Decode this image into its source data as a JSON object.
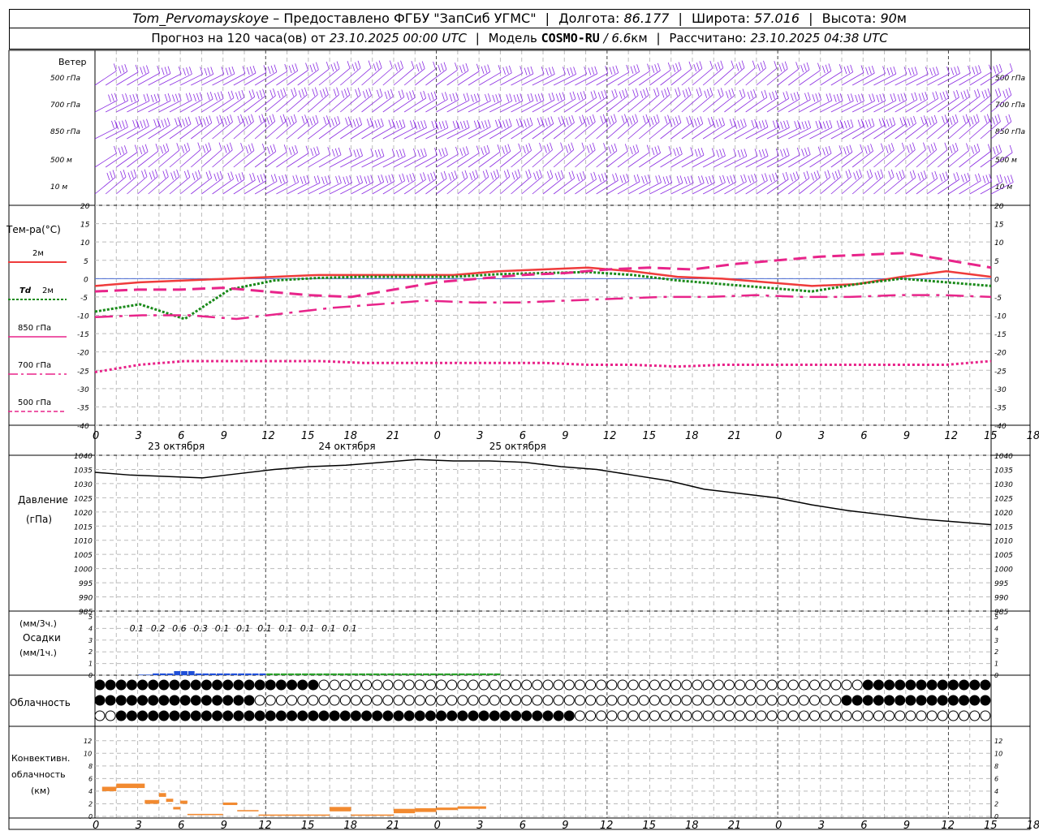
{
  "header": {
    "station": "Tom_Pervomayskoye",
    "provided_by": "– Предоставлено ФГБУ \"ЗапСиб УГМС\"",
    "lon_label": "Долгота:",
    "lon_value": "86.177",
    "lat_label": "Широта:",
    "lat_value": "57.016",
    "alt_label": "Высота:",
    "alt_value": "90",
    "alt_unit": "м",
    "forecast_prefix": "Прогноз на 120 часа(ов) от",
    "forecast_time": "23.10.2025 00:00 UTC",
    "model_label": "Модель",
    "model_name": "COSMO-RU",
    "model_res": "/ 6.6",
    "model_res_unit": "км",
    "calc_label": "Рассчитано:",
    "calc_time": "23.10.2025 04:38 UTC"
  },
  "x_ticks": [
    "0",
    "3",
    "6",
    "9",
    "12",
    "15",
    "18",
    "21",
    "0",
    "3",
    "6",
    "9",
    "12",
    "15",
    "18",
    "21",
    "0",
    "3",
    "6",
    "9",
    "12",
    "15",
    "18",
    "21",
    "0",
    "3",
    "6"
  ],
  "day_labels": [
    "23 октября",
    "24 октября",
    "25 октября"
  ],
  "wind_panel": {
    "title": "Ветер",
    "levels": [
      "500 гПа",
      "700 гПа",
      "850 гПа",
      "500 м",
      "10 м"
    ],
    "color": "#8a2be2"
  },
  "temp_panel": {
    "title": "Тем-ра(°С)",
    "y_ticks": [
      "20",
      "15",
      "10",
      "5",
      "0",
      "-5",
      "-10",
      "-15",
      "-20",
      "-25",
      "-30",
      "-35",
      "-40"
    ],
    "legend": [
      {
        "label": "2м",
        "color": "#ef3b3b"
      },
      {
        "label_it": "Td",
        "label": "2м",
        "color": "#1a8a1a"
      },
      {
        "label": "850 гПа",
        "color": "#e8248a"
      },
      {
        "label": "700 гПа",
        "color": "#e8248a"
      },
      {
        "label": "500 гПа",
        "color": "#e8248a"
      }
    ]
  },
  "pressure_panel": {
    "title": "Давление",
    "unit": "(гПа)",
    "y_ticks": [
      "1040",
      "1035",
      "1030",
      "1025",
      "1020",
      "1015",
      "1010",
      "1005",
      "1000",
      "995",
      "990",
      "985"
    ]
  },
  "precip_panel": {
    "unit_top": "(мм/3ч.)",
    "title": "Осадки",
    "unit_bottom": "(мм/1ч.)",
    "y_ticks": [
      "5",
      "4",
      "3",
      "2",
      "1",
      "0"
    ],
    "labels_3h": [
      "0.1",
      "0.2",
      "0.6",
      "0.3",
      "0.1",
      "0.1",
      "0.1",
      "0.1",
      "0.1",
      "0.1",
      "0.1"
    ]
  },
  "cloud_panel": {
    "title": "Облачность"
  },
  "conv_panel": {
    "title_line1": "Конвективн.",
    "title_line2": "облачность",
    "unit": "(км)",
    "y_ticks": [
      "12",
      "10",
      "8",
      "6",
      "4",
      "2",
      "0"
    ]
  },
  "chart_data": [
    {
      "type": "line",
      "title": "Тем-ра(°С)",
      "x_hours": [
        0,
        6,
        12,
        18,
        24,
        30,
        36,
        42,
        48,
        54,
        60,
        66,
        72,
        78,
        84,
        90,
        96,
        102,
        108,
        114,
        120
      ],
      "ylim": [
        -40,
        20
      ],
      "series": [
        {
          "name": "2м",
          "color": "#ef3b3b",
          "values": [
            -2,
            -1,
            -0.5,
            0,
            0.5,
            1,
            1,
            1,
            1,
            2,
            2.5,
            3,
            2,
            0.5,
            0,
            -1,
            -2,
            -1.5,
            0.5,
            2,
            0.5
          ]
        },
        {
          "name": "Td 2м",
          "color": "#1a8a1a",
          "values": [
            -9,
            -7,
            -11,
            -3,
            -0.5,
            0.2,
            0.5,
            0.5,
            0.5,
            1.2,
            1.5,
            1.8,
            1,
            -0.5,
            -1.5,
            -2.5,
            -3.5,
            -1.5,
            0,
            -1,
            -2
          ]
        },
        {
          "name": "850 гПа",
          "color": "#e8248a",
          "values": [
            -3.5,
            -3,
            -3,
            -2.5,
            -3.5,
            -4.5,
            -5,
            -3,
            -1,
            0,
            1,
            1.5,
            2.5,
            3,
            2.5,
            4,
            5,
            6,
            6.5,
            7,
            5,
            3
          ]
        },
        {
          "name": "700 гПа",
          "color": "#e8248a",
          "values": [
            -10.5,
            -10,
            -10,
            -11,
            -9.5,
            -8,
            -7,
            -6,
            -6.5,
            -6.5,
            -6,
            -5.5,
            -5,
            -5,
            -4.5,
            -5,
            -5,
            -4.5,
            -4.5,
            -5
          ]
        },
        {
          "name": "500 гПа",
          "color": "#e8248a",
          "values": [
            -25.5,
            -23.5,
            -22.5,
            -22.5,
            -22.5,
            -22.5,
            -23,
            -23,
            -23,
            -23,
            -23,
            -23.5,
            -23.5,
            -24,
            -23.5,
            -23.5,
            -23.5,
            -23.5,
            -23.5,
            -23.5,
            -22.5
          ]
        }
      ]
    },
    {
      "type": "line",
      "title": "Давление",
      "x_hours": [
        0,
        6,
        12,
        18,
        24,
        30,
        36,
        42,
        48,
        54,
        60,
        66,
        72,
        78,
        84,
        90,
        96,
        102,
        108,
        114,
        120
      ],
      "ylim": [
        985,
        1040
      ],
      "series": [
        {
          "name": "",
          "color": "#000000",
          "values": [
            1034,
            1033,
            1032.5,
            1032,
            1033.5,
            1035,
            1036,
            1036.5,
            1037.5,
            1038.5,
            1038,
            1038,
            1037.5,
            1036,
            1035,
            1033,
            1031,
            1028,
            1026.5,
            1025,
            1022.5,
            1020.5,
            1019,
            1017.5,
            1016.5,
            1015.5
          ]
        }
      ]
    },
    {
      "type": "bar",
      "title": "Осадки",
      "ylim": [
        0,
        5
      ],
      "labels_3h": [
        "0.1",
        "0.2",
        "0.6",
        "0.3",
        "0.1",
        "0.1",
        "0.1",
        "0.1",
        "0.1",
        "0.1",
        "0.1"
      ],
      "label_hours": [
        6,
        9,
        12,
        15,
        18,
        21,
        24,
        27,
        30,
        33,
        36
      ]
    },
    {
      "type": "bar",
      "title": "Конвективн. облачность",
      "ylim": [
        0,
        13
      ],
      "segments": [
        {
          "h0": 1,
          "h1": 3,
          "bottom": 4,
          "top": 4.7
        },
        {
          "h0": 3,
          "h1": 7,
          "bottom": 4.5,
          "top": 5.2
        },
        {
          "h0": 7,
          "h1": 9,
          "bottom": 2,
          "top": 2.6
        },
        {
          "h0": 9,
          "h1": 10,
          "bottom": 3.1,
          "top": 3.7
        },
        {
          "h0": 10,
          "h1": 11,
          "bottom": 2.3,
          "top": 2.8
        },
        {
          "h0": 11,
          "h1": 12,
          "bottom": 1.1,
          "top": 1.5
        },
        {
          "h0": 12,
          "h1": 13,
          "bottom": 2,
          "top": 2.5
        },
        {
          "h0": 13,
          "h1": 18,
          "bottom": 0.2,
          "top": 0.4
        },
        {
          "h0": 18,
          "h1": 20,
          "bottom": 1.8,
          "top": 2.2
        },
        {
          "h0": 20,
          "h1": 23,
          "bottom": 0.8,
          "top": 1
        },
        {
          "h0": 23,
          "h1": 33,
          "bottom": 0.1,
          "top": 0.3
        },
        {
          "h0": 33,
          "h1": 36,
          "bottom": 0.8,
          "top": 1.5
        },
        {
          "h0": 36,
          "h1": 42,
          "bottom": 0.1,
          "top": 0.3
        },
        {
          "h0": 42,
          "h1": 45,
          "bottom": 0.5,
          "top": 1.2
        },
        {
          "h0": 45,
          "h1": 48,
          "bottom": 0.7,
          "top": 1.3
        },
        {
          "h0": 48,
          "h1": 51,
          "bottom": 1,
          "top": 1.4
        },
        {
          "h0": 51,
          "h1": 55,
          "bottom": 1.2,
          "top": 1.6
        }
      ]
    }
  ]
}
